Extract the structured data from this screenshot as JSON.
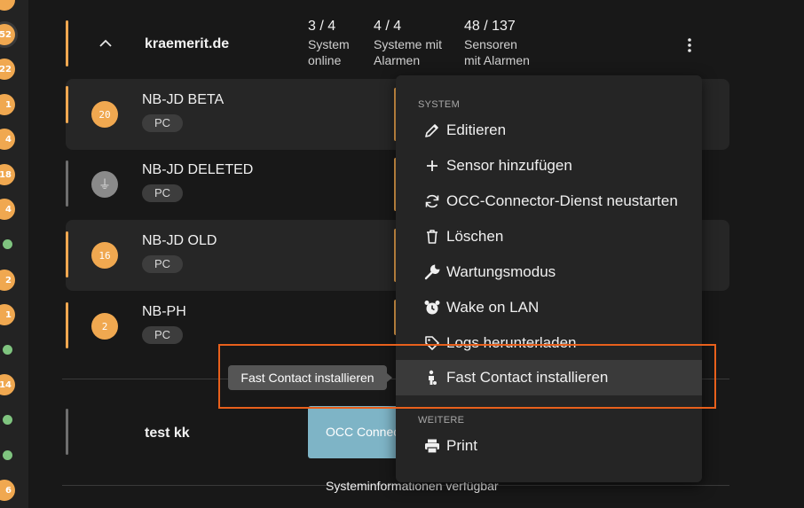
{
  "sidebar": {
    "badges": [
      "52",
      "22",
      "1",
      "4",
      "18",
      "4",
      "2",
      "1",
      "14",
      "6"
    ]
  },
  "group": {
    "title": "kraemerit.de",
    "stats": [
      {
        "value": "3 / 4",
        "label": "System\nonline"
      },
      {
        "value": "4 / 4",
        "label": "Systeme mit\nAlarmen"
      },
      {
        "value": "48 / 137",
        "label": "Sensoren\nmit Alarmen"
      }
    ]
  },
  "systems": [
    {
      "name": "NB-JD BETA",
      "tag": "PC",
      "badge": "20"
    },
    {
      "name": "NB-JD DELETED",
      "tag": "PC",
      "badge": "⏚"
    },
    {
      "name": "NB-JD OLD",
      "tag": "PC",
      "badge": "16"
    },
    {
      "name": "NB-PH",
      "tag": "PC",
      "badge": "2"
    }
  ],
  "test_group": {
    "title": "test kk",
    "occ_button": "OCC Connector"
  },
  "system_info": "Systeminformationen verfügbar",
  "menu": {
    "section_system": "SYSTEM",
    "items": [
      {
        "label": "Editieren",
        "icon": "pencil-icon"
      },
      {
        "label": "Sensor hinzufügen",
        "icon": "plus-icon"
      },
      {
        "label": "OCC-Connector-Dienst neustarten",
        "icon": "refresh-icon"
      },
      {
        "label": "Löschen",
        "icon": "trash-icon"
      },
      {
        "label": "Wartungsmodus",
        "icon": "wrench-icon"
      },
      {
        "label": "Wake on LAN",
        "icon": "alarm-clock-icon"
      },
      {
        "label": "Logs herunterladen",
        "icon": "tag-icon"
      },
      {
        "label": "Fast Contact installieren",
        "icon": "person-hand-icon"
      }
    ],
    "section_other": "WEITERE",
    "print_label": "Print"
  },
  "tooltip": "Fast Contact installieren",
  "colors": {
    "accent": "#f0a850",
    "highlight": "#e8601c"
  }
}
